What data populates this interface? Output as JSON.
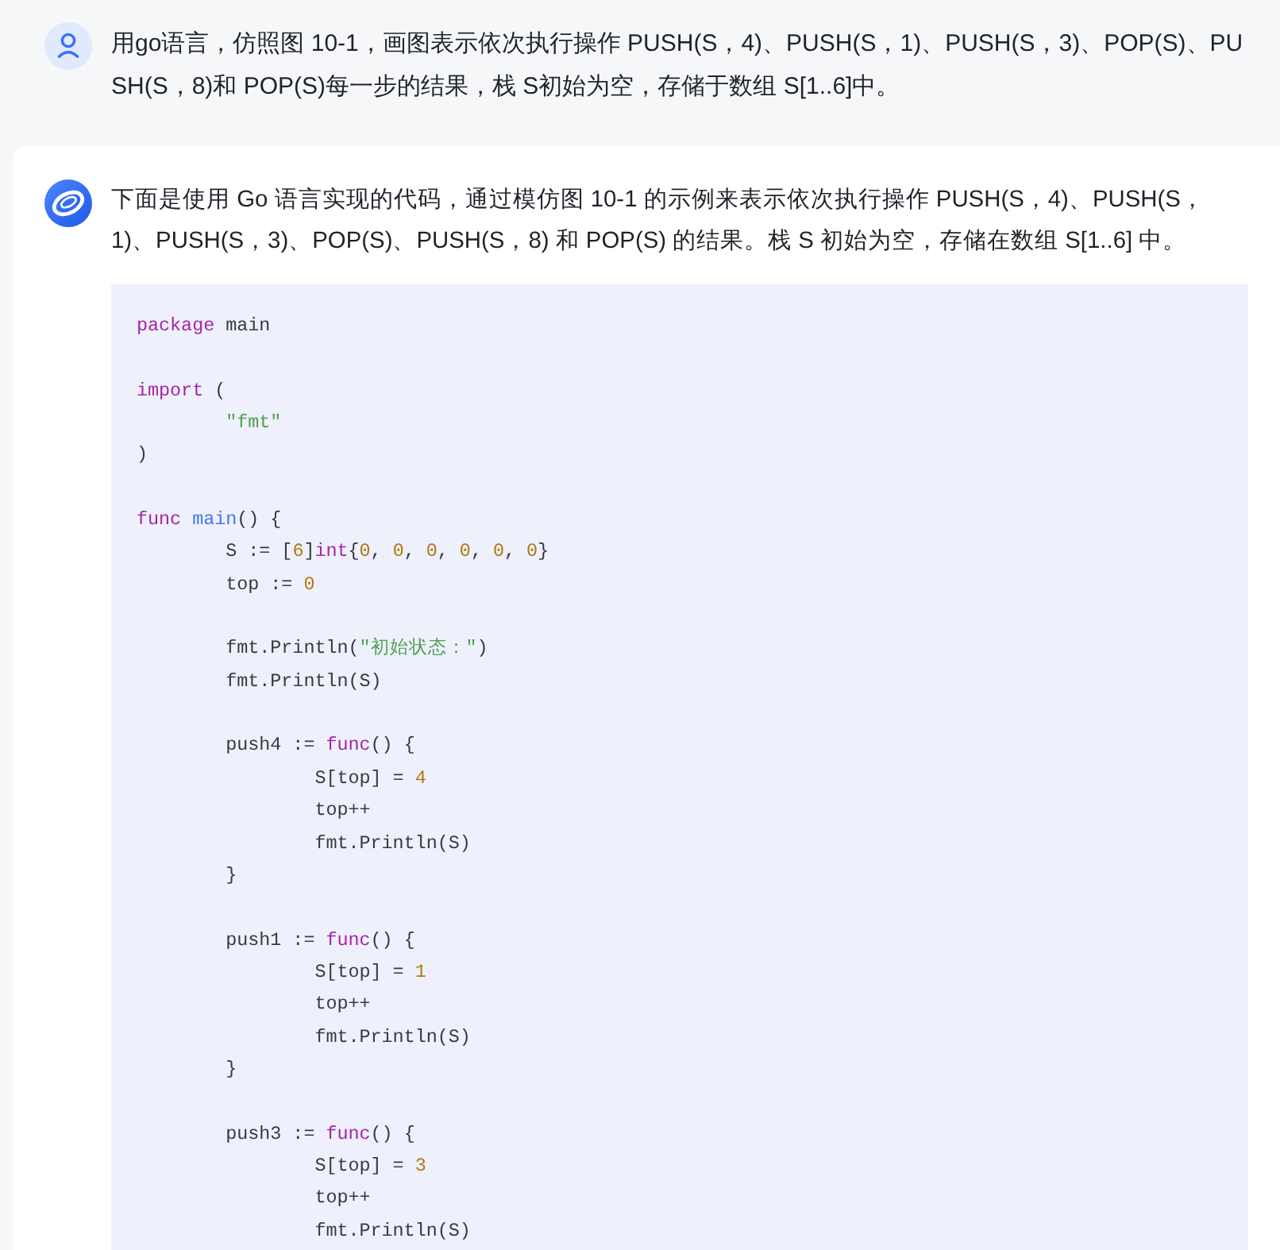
{
  "question": {
    "text": "用go语言，仿照图 10-1，画图表示依次执行操作 PUSH(S，4)、PUSH(S，1)、PUSH(S，3)、POP(S)、PUSH(S，8)和 POP(S)每一步的结果，栈 S初始为空，存储于数组 S[1..6]中。"
  },
  "answer": {
    "text": "下面是使用 Go 语言实现的代码，通过模仿图 10-1 的示例来表示依次执行操作 PUSH(S，4)、PUSH(S，1)、PUSH(S，3)、POP(S)、PUSH(S，8) 和 POP(S) 的结果。栈 S 初始为空，存储在数组 S[1..6] 中。",
    "code": {
      "blocks": [
        {
          "lines": [
            {
              "tokens": [
                {
                  "kind": "keyword",
                  "text": "package"
                },
                {
                  "kind": "plain",
                  "text": " main"
                }
              ]
            }
          ]
        },
        {
          "lines": [
            {
              "tokens": [
                {
                  "kind": "keyword",
                  "text": "import"
                },
                {
                  "kind": "plain",
                  "text": " ("
                }
              ],
              "blocks": [
                {
                  "lines": [
                    {
                      "tokens": [
                        {
                          "kind": "string",
                          "text": "\"fmt\""
                        }
                      ]
                    }
                  ]
                }
              ]
            },
            {
              "tokens": [
                {
                  "kind": "plain",
                  "text": ")"
                }
              ]
            }
          ]
        },
        {
          "lines": [
            {
              "tokens": [
                {
                  "kind": "keyword",
                  "text": "func"
                },
                {
                  "kind": "function",
                  "text": " main"
                },
                {
                  "kind": "plain",
                  "text": "() {"
                }
              ],
              "blocks": [
                {
                  "lines": [
                    {
                      "tokens": [
                        {
                          "kind": "plain",
                          "text": "S := ["
                        },
                        {
                          "kind": "number",
                          "text": "6"
                        },
                        {
                          "kind": "plain",
                          "text": "]"
                        },
                        {
                          "kind": "keyword",
                          "text": "int"
                        },
                        {
                          "kind": "plain",
                          "text": "{"
                        },
                        {
                          "kind": "number",
                          "text": "0"
                        },
                        {
                          "kind": "plain",
                          "text": ", "
                        },
                        {
                          "kind": "number",
                          "text": "0"
                        },
                        {
                          "kind": "plain",
                          "text": ", "
                        },
                        {
                          "kind": "number",
                          "text": "0"
                        },
                        {
                          "kind": "plain",
                          "text": ", "
                        },
                        {
                          "kind": "number",
                          "text": "0"
                        },
                        {
                          "kind": "plain",
                          "text": ", "
                        },
                        {
                          "kind": "number",
                          "text": "0"
                        },
                        {
                          "kind": "plain",
                          "text": ", "
                        },
                        {
                          "kind": "number",
                          "text": "0"
                        },
                        {
                          "kind": "plain",
                          "text": "}"
                        }
                      ]
                    },
                    {
                      "tokens": [
                        {
                          "kind": "plain",
                          "text": "top := "
                        },
                        {
                          "kind": "number",
                          "text": "0"
                        }
                      ]
                    }
                  ]
                },
                {
                  "lines": [
                    {
                      "tokens": [
                        {
                          "kind": "plain",
                          "text": "fmt.Println("
                        },
                        {
                          "kind": "string",
                          "text": "\"初始状态：\""
                        },
                        {
                          "kind": "plain",
                          "text": ")"
                        }
                      ]
                    },
                    {
                      "tokens": [
                        {
                          "kind": "plain",
                          "text": "fmt.Println(S)"
                        }
                      ]
                    }
                  ]
                },
                {
                  "lines": [
                    {
                      "tokens": [
                        {
                          "kind": "plain",
                          "text": "push4 := "
                        },
                        {
                          "kind": "keyword",
                          "text": "func"
                        },
                        {
                          "kind": "plain",
                          "text": "() {"
                        }
                      ],
                      "blocks": [
                        {
                          "lines": [
                            {
                              "tokens": [
                                {
                                  "kind": "plain",
                                  "text": "S[top] = "
                                },
                                {
                                  "kind": "number",
                                  "text": "4"
                                }
                              ]
                            },
                            {
                              "tokens": [
                                {
                                  "kind": "plain",
                                  "text": "top++"
                                }
                              ]
                            },
                            {
                              "tokens": [
                                {
                                  "kind": "plain",
                                  "text": "fmt.Println(S)"
                                }
                              ]
                            }
                          ]
                        }
                      ]
                    },
                    {
                      "tokens": [
                        {
                          "kind": "plain",
                          "text": "}"
                        }
                      ]
                    }
                  ]
                },
                {
                  "lines": [
                    {
                      "tokens": [
                        {
                          "kind": "plain",
                          "text": "push1 := "
                        },
                        {
                          "kind": "keyword",
                          "text": "func"
                        },
                        {
                          "kind": "plain",
                          "text": "() {"
                        }
                      ],
                      "blocks": [
                        {
                          "lines": [
                            {
                              "tokens": [
                                {
                                  "kind": "plain",
                                  "text": "S[top] = "
                                },
                                {
                                  "kind": "number",
                                  "text": "1"
                                }
                              ]
                            },
                            {
                              "tokens": [
                                {
                                  "kind": "plain",
                                  "text": "top++"
                                }
                              ]
                            },
                            {
                              "tokens": [
                                {
                                  "kind": "plain",
                                  "text": "fmt.Println(S)"
                                }
                              ]
                            }
                          ]
                        }
                      ]
                    },
                    {
                      "tokens": [
                        {
                          "kind": "plain",
                          "text": "}"
                        }
                      ]
                    }
                  ]
                },
                {
                  "lines": [
                    {
                      "tokens": [
                        {
                          "kind": "plain",
                          "text": "push3 := "
                        },
                        {
                          "kind": "keyword",
                          "text": "func"
                        },
                        {
                          "kind": "plain",
                          "text": "() {"
                        }
                      ],
                      "blocks": [
                        {
                          "lines": [
                            {
                              "tokens": [
                                {
                                  "kind": "plain",
                                  "text": "S[top] = "
                                },
                                {
                                  "kind": "number",
                                  "text": "3"
                                }
                              ]
                            },
                            {
                              "tokens": [
                                {
                                  "kind": "plain",
                                  "text": "top++"
                                }
                              ]
                            },
                            {
                              "tokens": [
                                {
                                  "kind": "plain",
                                  "text": "fmt.Println(S)"
                                }
                              ]
                            }
                          ]
                        }
                      ]
                    }
                  ]
                }
              ]
            }
          ]
        }
      ]
    }
  }
}
